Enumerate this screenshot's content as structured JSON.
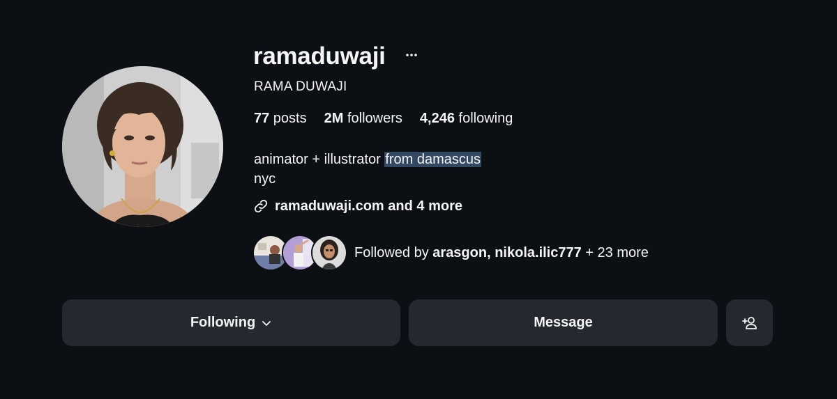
{
  "profile": {
    "username": "ramaduwaji",
    "full_name": "RAMA DUWAJI",
    "more_icon": "ellipsis-icon"
  },
  "stats": {
    "posts_count": "77",
    "posts_label": " posts",
    "followers_count": "2M",
    "followers_label": " followers",
    "following_count": "4,246",
    "following_label": " following"
  },
  "bio": {
    "line1_plain": "animator + illustrator ",
    "line1_selected": "from damascus",
    "line2": "nyc",
    "selection_color": "#324863"
  },
  "links": {
    "icon": "link-icon",
    "text": "ramaduwaji.com and 4 more"
  },
  "followed_by": {
    "prefix": "Followed by ",
    "user1": "arasgon",
    "separator": ", ",
    "user2": "nikola.ilic777",
    "suffix": " + 23 more"
  },
  "actions": {
    "following_label": "Following",
    "following_icon": "chevron-down-icon",
    "message_label": "Message",
    "suggest_icon": "add-person-icon"
  },
  "colors": {
    "background": "#0c0f14",
    "button": "#25282e",
    "text": "#f5f5f5"
  }
}
